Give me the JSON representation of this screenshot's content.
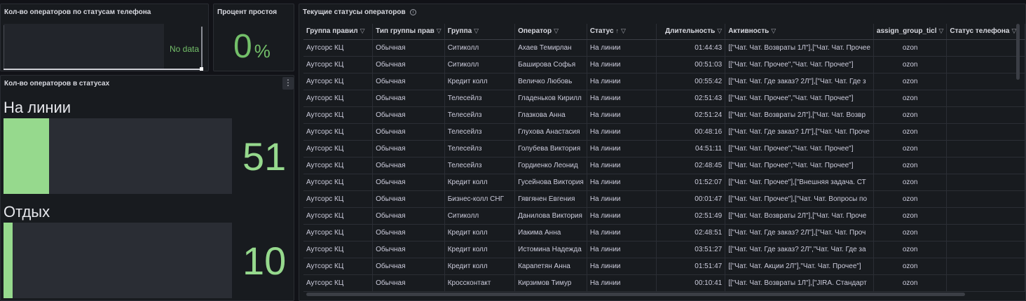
{
  "phone_panel": {
    "title": "Кол-во операторов по статусам телефона",
    "no_data": "No data"
  },
  "idle_panel": {
    "title": "Процент простоя",
    "value": "0",
    "unit": "%",
    "color": "#73bf69"
  },
  "states_panel": {
    "title": "Кол-во операторов в статусах",
    "menu_icon": "kebab-menu-icon",
    "bar_color": "#96d98d",
    "max": 320,
    "items": [
      {
        "name": "На линии",
        "value": "51",
        "fraction": 0.2
      },
      {
        "name": "Отдых",
        "value": "10",
        "fraction": 0.04
      }
    ]
  },
  "table_panel": {
    "title": "Текущие статусы операторов",
    "info_icon": "info-icon",
    "columns": [
      {
        "label": "Группа правил",
        "filter": true
      },
      {
        "label": "Тип группы прав",
        "filter": true
      },
      {
        "label": "Группа",
        "filter": true
      },
      {
        "label": "Оператор",
        "filter": true
      },
      {
        "label": "Статус",
        "sort": "↑",
        "filter": true
      },
      {
        "label": "Длительность",
        "filter": true
      },
      {
        "label": "Активность",
        "filter": true
      },
      {
        "label": "assign_group_ticl",
        "filter": true
      },
      {
        "label": "Статус телефона",
        "filter": true
      }
    ],
    "rows": [
      [
        "Аутсорс КЦ",
        "Обычная",
        "Ситиколл",
        "Ахаев Темирлан",
        "На линии",
        "01:44:43",
        "[[\"Чат. Чат. Возвраты 1Л\"],[\"Чат. Чат. Прочее",
        "ozon",
        ""
      ],
      [
        "Аутсорс КЦ",
        "Обычная",
        "Ситиколл",
        "Баширова Софья",
        "На линии",
        "00:51:03",
        "[[\"Чат. Чат. Прочее\",\"Чат. Чат. Прочее\"]",
        "ozon",
        ""
      ],
      [
        "Аутсорс КЦ",
        "Обычная",
        "Кредит колл",
        "Величко Любовь",
        "На линии",
        "00:55:42",
        "[[\"Чат. Чат. Где заказ? 2Л\"],[\"Чат. Чат. Где з",
        "ozon",
        ""
      ],
      [
        "Аутсорс КЦ",
        "Обычная",
        "Телесейлз",
        "Гладеньков Кирилл",
        "На линии",
        "02:51:43",
        "[[\"Чат. Чат. Прочее\",\"Чат. Чат. Прочее\"]",
        "ozon",
        ""
      ],
      [
        "Аутсорс КЦ",
        "Обычная",
        "Телесейлз",
        "Глазкова Анна",
        "На линии",
        "02:51:24",
        "[[\"Чат. Чат. Возвраты 2Л\"],[\"Чат. Чат. Возвр",
        "ozon",
        ""
      ],
      [
        "Аутсорс КЦ",
        "Обычная",
        "Телесейлз",
        "Глухова Анастасия",
        "На линии",
        "00:48:16",
        "[[\"Чат. Чат. Где заказ? 1Л\"],[\"Чат. Чат. Проче",
        "ozon",
        ""
      ],
      [
        "Аутсорс КЦ",
        "Обычная",
        "Телесейлз",
        "Голубева Виктория",
        "На линии",
        "04:51:11",
        "[[\"Чат. Чат. Прочее\",\"Чат. Чат. Прочее\"]",
        "ozon",
        ""
      ],
      [
        "Аутсорс КЦ",
        "Обычная",
        "Телесейлз",
        "Гордиенко Леонид",
        "На линии",
        "02:48:45",
        "[[\"Чат. Чат. Прочее\",\"Чат. Чат. Прочее\"]",
        "ozon",
        ""
      ],
      [
        "Аутсорс КЦ",
        "Обычная",
        "Кредит колл",
        "Гусейнова Виктория",
        "На линии",
        "01:52:07",
        "[[\"Чат. Чат. Прочее\"],[\"Внешняя задача. СТ",
        "ozon",
        ""
      ],
      [
        "Аутсорс КЦ",
        "Обычная",
        "Бизнес-колл СНГ",
        "Гявгянен Евгения",
        "На линии",
        "00:01:47",
        "[[\"Чат. Чат. Прочее\"],[\"Чат. Чат. Вопросы по",
        "ozon",
        ""
      ],
      [
        "Аутсорс КЦ",
        "Обычная",
        "Ситиколл",
        "Данилова Виктория",
        "На линии",
        "02:51:49",
        "[[\"Чат. Чат. Возвраты 2Л\"],[\"Чат. Чат. Проче",
        "ozon",
        ""
      ],
      [
        "Аутсорс КЦ",
        "Обычная",
        "Кредит колл",
        "Иакима Анна",
        "На линии",
        "02:48:51",
        "[[\"Чат. Чат. Где заказ? 2Л\"],[\"Чат. Чат. Проч",
        "ozon",
        ""
      ],
      [
        "Аутсорс КЦ",
        "Обычная",
        "Кредит колл",
        "Истомина Надежда",
        "На линии",
        "03:51:27",
        "[[\"Чат. Чат. Где заказ? 2Л\",\"Чат. Чат. Где за",
        "ozon",
        ""
      ],
      [
        "Аутсорс КЦ",
        "Обычная",
        "Кредит колл",
        "Карапетян Анна",
        "На линии",
        "01:51:47",
        "[[\"Чат. Чат. Акции 2Л\"],\"Чат. Чат. Прочее\"]",
        "ozon",
        ""
      ],
      [
        "Аутсорс КЦ",
        "Обычная",
        "Кроссконтакт",
        "Кирзимов Тимур",
        "На линии",
        "00:10:41",
        "[[\"Чат. Чат. Возвраты 1Л\"],[\"JIRA. Стандарт",
        "ozon",
        ""
      ]
    ]
  }
}
